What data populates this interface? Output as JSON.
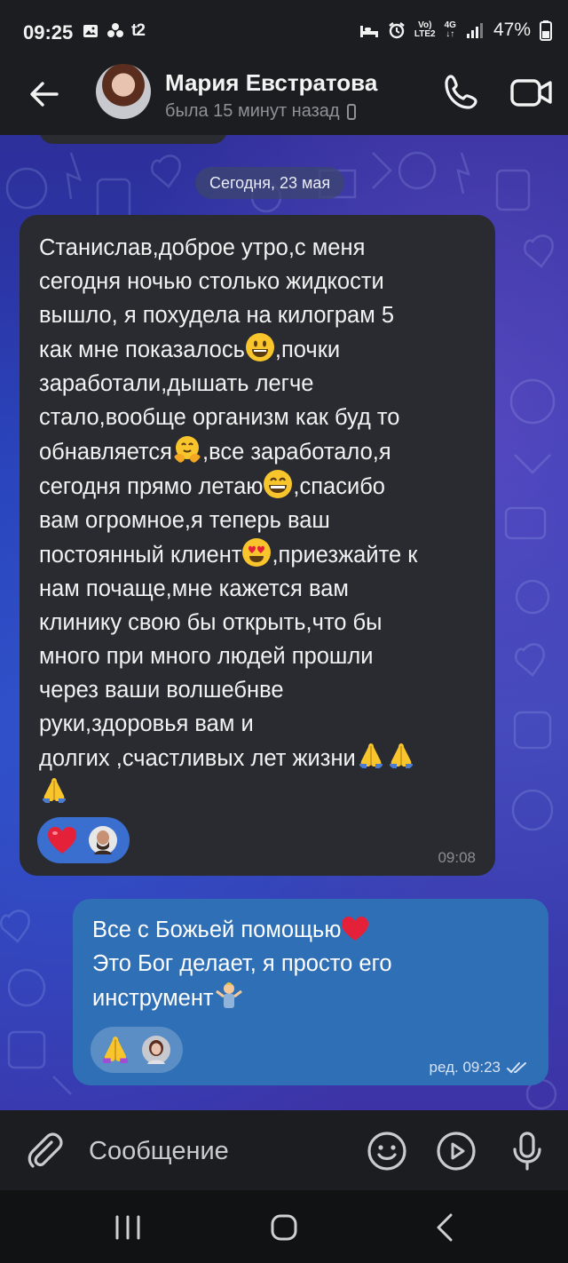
{
  "status_bar": {
    "time": "09:25",
    "carrier": "t2",
    "network_label_top": "Vo)",
    "network_label_bottom": "LTE2",
    "network_gen": "4G",
    "battery": "47%"
  },
  "header": {
    "contact_name": "Мария Евстратова",
    "last_seen": "была 15 минут назад"
  },
  "chat": {
    "date_separator": "Сегодня, 23 мая",
    "incoming": {
      "text_parts": [
        "Станислав,доброе утро,с меня\nсегодня ночью столько жидкости\nвышло, я похудела на килограм 5\nкак мне показалось",
        ",почки\nзаработали,дышать легче\nстало,вообще организм как буд то\nобнавляется",
        ",все заработало,я\nсегодня прямо летаю",
        ",спасибо\nвам огромное,я теперь ваш\nпостоянный клиент",
        ",приезжайте к\nнам почаще,мне кажется вам\nклинику свою бы открыть,что бы\nмного при много людей прошли\nчерез ваши волшебнве\nруки,здоровья вам и\nдолгих ,счастливых лет жизни"
      ],
      "time": "09:08",
      "reactions": [
        "heart",
        "avatar"
      ]
    },
    "outgoing": {
      "text_parts": [
        "Все с Божьей помощью",
        "\nЭто Бог делает, я просто его\nинструмент"
      ],
      "time": "ред. 09:23",
      "status": "read",
      "reactions": [
        "folded-hands",
        "avatar"
      ]
    }
  },
  "input": {
    "placeholder": "Сообщение"
  },
  "icons": {
    "back": "arrow-left-icon",
    "call": "phone-icon",
    "video": "video-camera-icon",
    "attach": "paperclip-icon",
    "emoji": "smiley-icon",
    "video_message": "play-circle-icon",
    "mic": "microphone-icon"
  },
  "colors": {
    "incoming_bubble": "#2a2b30",
    "outgoing_bubble": "#2f6fb6",
    "reaction_pill": "#3a6fcf",
    "chat_bg": "#2a3fb5"
  }
}
